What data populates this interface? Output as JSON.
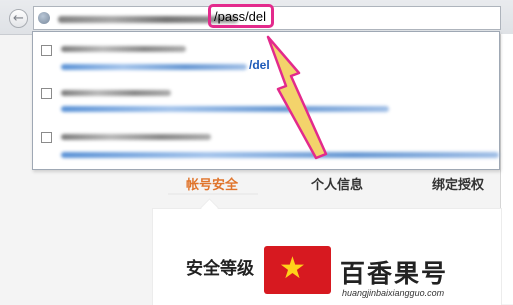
{
  "browser": {
    "address_url_suffix": "/pass/del",
    "back_icon": "back-arrow-icon",
    "site_icon": "globe-icon"
  },
  "dropdown": {
    "suggestions": [
      {
        "suffix": "/del"
      },
      {
        "suffix": ""
      },
      {
        "suffix": ""
      }
    ]
  },
  "page": {
    "tabs": [
      "帐号安全",
      "个人信息",
      "绑定授权"
    ],
    "active_tab": "帐号安全",
    "section_title": "安全等级"
  },
  "colors": {
    "highlight": "#e32a8c",
    "active_tab": "#e0742b",
    "arrow": "#f3d36b",
    "watermark_red": "#d71920"
  },
  "watermark": {
    "brand": "百香果号",
    "url": "huangjinbaixiangguo.com",
    "logo_icon": "star-swoosh-icon"
  }
}
